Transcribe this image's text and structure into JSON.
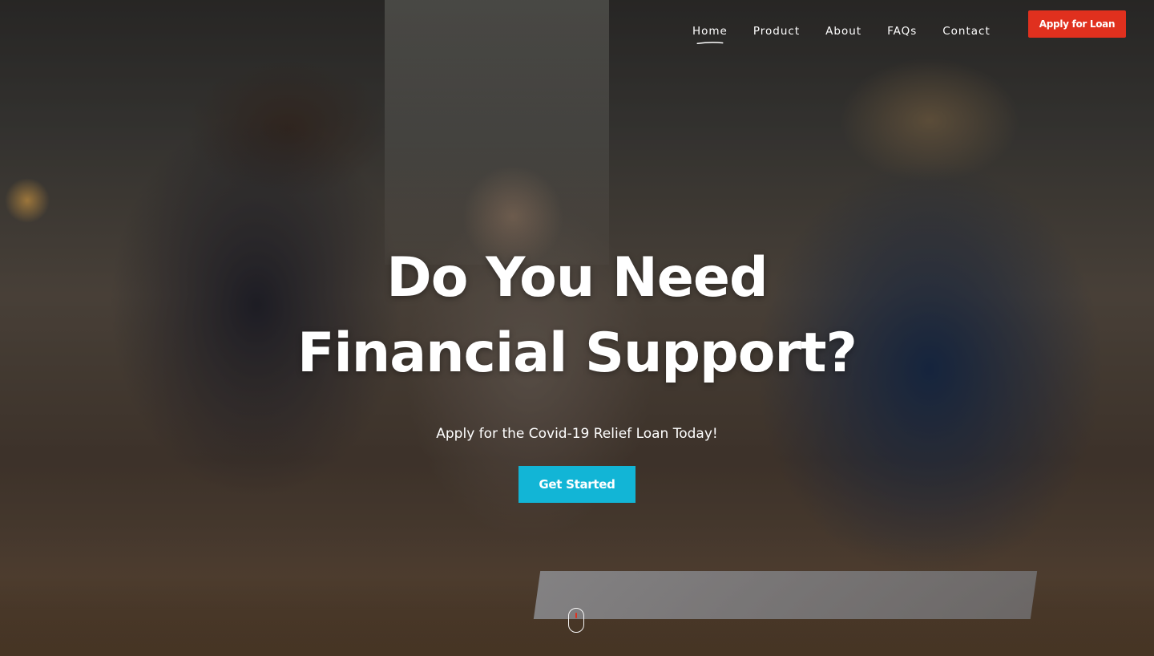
{
  "nav": {
    "items": [
      {
        "label": "Home",
        "active": true
      },
      {
        "label": "Product",
        "active": false
      },
      {
        "label": "About",
        "active": false
      },
      {
        "label": "FAQs",
        "active": false
      },
      {
        "label": "Contact",
        "active": false
      }
    ],
    "apply_button_label": "Apply for Loan"
  },
  "hero": {
    "headline_line1": "Do You Need",
    "headline_line2": "Financial Support?",
    "subheadline": "Apply for the Covid-19 Relief Loan Today!",
    "cta_label": "Get Started",
    "scroll_indicator_icon": "mouse-scroll-icon"
  },
  "colors": {
    "accent_red": "#e0301e",
    "cta_cyan": "#12b5d6",
    "text_white": "#ffffff"
  }
}
